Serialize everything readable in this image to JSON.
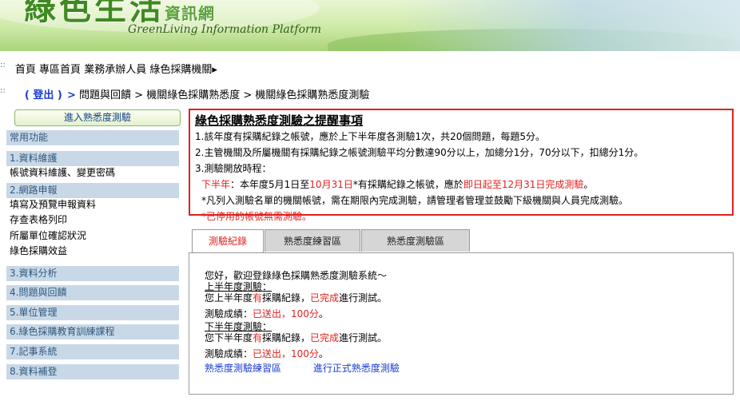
{
  "banner": {
    "logo_text": "綠色生活",
    "logo_small": "資訊網",
    "subtitle": "GreenLiving Information Platform"
  },
  "breadcrumb_top": {
    "home": "首頁",
    "area_home": "專區首頁",
    "role": "業務承辦人員",
    "agency": "綠色採購機關",
    "arrow": "▸"
  },
  "breadcrumb_path": {
    "login": "( 登出 )",
    "gt": ">",
    "items": [
      "問題與回饋",
      "機關綠色採購熟悉度",
      "機關綠色採購熟悉度測驗"
    ],
    "sep": ">"
  },
  "sidebar": {
    "enter_button": "進入熟悉度測驗",
    "common": "常用功能",
    "sections": [
      {
        "label": "1.資料維護"
      },
      {
        "label": "2.網路申報"
      },
      {
        "label": "3.資料分析"
      },
      {
        "label": "4.問題與回饋"
      },
      {
        "label": "5.單位管理"
      },
      {
        "label": "6.綠色採購教育訓練課程"
      },
      {
        "label": "7.記事系統"
      },
      {
        "label": "8.資料補登"
      }
    ],
    "items_s1": [
      "帳號資料維護、變更密碼"
    ],
    "items_s2": [
      "填寫及預覽申報資料",
      "存查表格列印",
      "所屬單位確認狀況",
      "綠色採購效益"
    ]
  },
  "notice": {
    "title": "綠色採購熟悉度測驗之提醒事項",
    "line1": "1.該年度有採購紀錄之帳號，應於上下半年度各測驗1次，共20個問題，每題5分。",
    "line2": "2.主管機關及所屬機關有採購紀錄之帳號測驗平均分數達90分以上，加總分1分，70分以下，扣總分1分。",
    "line3": "3.測驗開放時程：",
    "line4_a": "下半年",
    "line4_b": "：本年度5月1日至",
    "line4_c": "10月31日",
    "line4_d": "*有採購紀錄之帳號，應於",
    "line4_e": "即日起至12月31日完成測驗",
    "line4_f": "。",
    "line5": "*凡列入測驗名單的機關帳號，需在期限內完成測驗，請管理者管理並鼓勵下級機關與人員完成測驗。",
    "line6": "*已停用的帳號無需測驗。"
  },
  "tabs": [
    {
      "label": "測驗紀錄",
      "active": true
    },
    {
      "label": "熟悉度練習區",
      "active": false
    },
    {
      "label": "熟悉度測驗區",
      "active": false
    }
  ],
  "panel": {
    "welcome": "您好，歡迎登錄綠色採購熟悉度測驗系統～",
    "h1_title": "上半年度測驗：",
    "h1_a": "您上半年度",
    "has": "有",
    "h1_b": "採購紀錄，",
    "done": "已完成",
    "h1_c": "進行測試。",
    "score_a": "測驗成績：",
    "sent": "已送出，100分",
    "score_b": "。",
    "h2_title": "下半年度測驗：",
    "h2_a": "您下半年度",
    "link_practice": "熟悉度測驗練習區",
    "link_formal": "進行正式熟悉度測驗"
  }
}
